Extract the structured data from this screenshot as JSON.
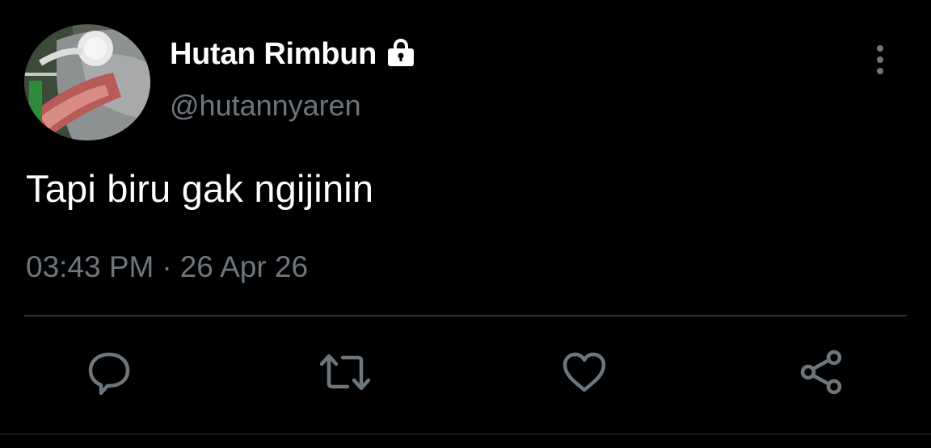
{
  "author": {
    "display_name": "Hutan Rimbun",
    "handle": "@hutannyaren",
    "protected": true
  },
  "tweet": {
    "text": "Tapi biru gak ngijinin",
    "time": "03:43 PM",
    "separator": "·",
    "date": "26 Apr 26"
  },
  "actions": [
    {
      "name": "reply",
      "icon": "reply-icon"
    },
    {
      "name": "retweet",
      "icon": "retweet-icon"
    },
    {
      "name": "like",
      "icon": "heart-icon"
    },
    {
      "name": "share",
      "icon": "share-icon"
    }
  ],
  "colors": {
    "background": "#000000",
    "primary_text": "#ffffff",
    "secondary_text": "#6e767d",
    "divider": "#2f3336",
    "icon": "#6e767d"
  }
}
